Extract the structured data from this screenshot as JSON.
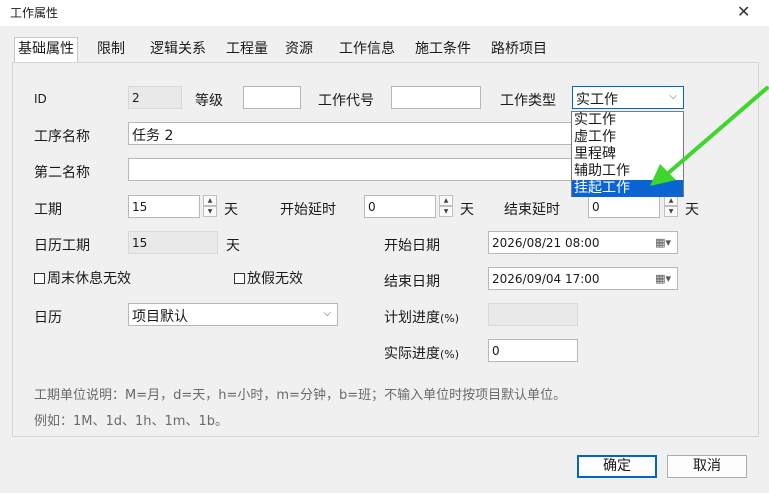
{
  "window": {
    "title": "工作属性",
    "close_glyph": "✕"
  },
  "tabs": [
    "基础属性",
    "限制",
    "逻辑关系",
    "工程量",
    "资源",
    "工作信息",
    "施工条件",
    "路桥项目"
  ],
  "form": {
    "id_label": "ID",
    "id_value": "2",
    "grade_label": "等级",
    "grade_value": "",
    "code_label": "工作代号",
    "code_value": "",
    "type_label": "工作类型",
    "type_value": "实工作",
    "type_options": [
      "实工作",
      "虚工作",
      "里程碑",
      "辅助工作",
      "挂起工作"
    ],
    "type_highlighted": "挂起工作",
    "name_label": "工序名称",
    "name_value": "任务 2",
    "second_name_label": "第二名称",
    "second_name_value": "",
    "duration_label": "工期",
    "duration_value": "15",
    "day_unit": "天",
    "start_delay_label": "开始延时",
    "start_delay_value": "0",
    "end_delay_label": "结束延时",
    "end_delay_value": "0",
    "calendar_duration_label": "日历工期",
    "calendar_duration_value": "15",
    "start_date_label": "开始日期",
    "start_date_value": "2026/08/21 08:00",
    "end_date_label": "结束日期",
    "end_date_value": "2026/09/04 17:00",
    "weekend_rest_label": "周末休息无效",
    "holiday_label": "放假无效",
    "calendar_label": "日历",
    "calendar_value": "项目默认",
    "plan_progress_label": "计划进度",
    "actual_progress_label": "实际进度",
    "percent_unit": "(%)",
    "plan_progress_value": "",
    "actual_progress_value": "0",
    "note_line1": "工期单位说明：M=月，d=天，h=小时，m=分钟，b=班；不输入单位时按项目默认单位。",
    "note_line2": "例如：1M、1d、1h、1m、1b。"
  },
  "buttons": {
    "ok": "确定",
    "cancel": "取消"
  },
  "colors": {
    "highlight": "#0a64d2",
    "arrow": "#3ed62c",
    "primary_border": "#0067c0"
  }
}
